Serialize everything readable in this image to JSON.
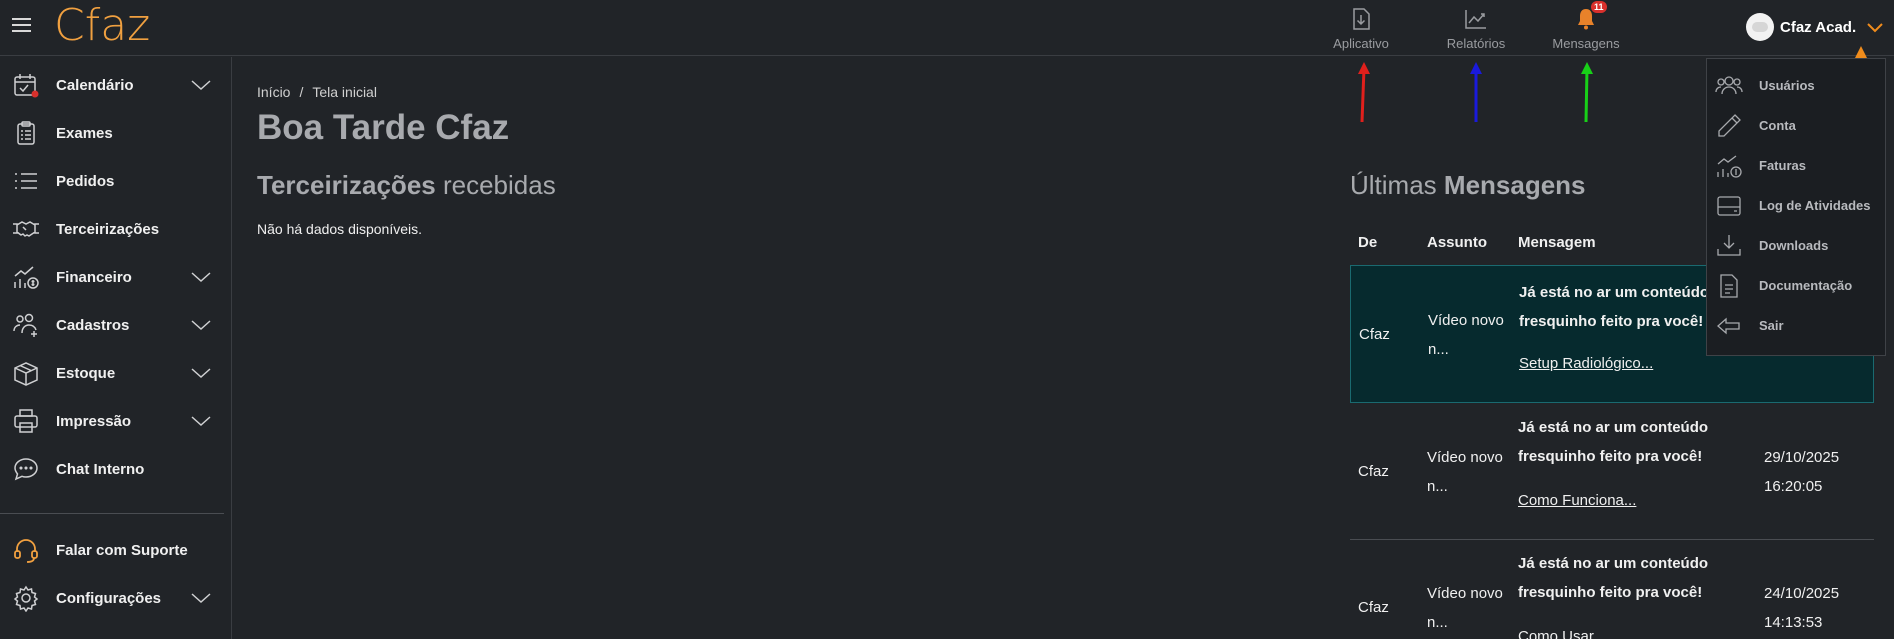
{
  "app": {
    "logo": "Cfaz"
  },
  "topnav": [
    {
      "label": "Aplicativo",
      "icon": "download-file-icon"
    },
    {
      "label": "Relatórios",
      "icon": "trend-chart-icon"
    },
    {
      "label": "Mensagens",
      "icon": "bell-icon",
      "badge": "11"
    }
  ],
  "user": {
    "name": "Cfaz Acad."
  },
  "sidebar": {
    "items": [
      {
        "label": "Calendário",
        "icon": "calendar-icon",
        "expandable": true
      },
      {
        "label": "Exames",
        "icon": "clipboard-icon",
        "expandable": false
      },
      {
        "label": "Pedidos",
        "icon": "list-icon",
        "expandable": false
      },
      {
        "label": "Terceirizações",
        "icon": "handshake-icon",
        "expandable": false
      },
      {
        "label": "Financeiro",
        "icon": "finance-icon",
        "expandable": true
      },
      {
        "label": "Cadastros",
        "icon": "users-icon",
        "expandable": true
      },
      {
        "label": "Estoque",
        "icon": "box-icon",
        "expandable": true
      },
      {
        "label": "Impressão",
        "icon": "printer-icon",
        "expandable": true
      },
      {
        "label": "Chat Interno",
        "icon": "chat-icon",
        "expandable": false
      }
    ],
    "bottom_items": [
      {
        "label": "Falar com Suporte",
        "icon": "headset-icon",
        "expandable": false
      },
      {
        "label": "Configurações",
        "icon": "gear-icon",
        "expandable": true
      }
    ]
  },
  "breadcrumb": {
    "home": "Início",
    "separator": "/",
    "current": "Tela inicial"
  },
  "greeting": "Boa Tarde Cfaz",
  "outsourcing": {
    "title_bold": "Terceirizações",
    "title_rest": " recebidas",
    "empty": "Não há dados disponíveis."
  },
  "messages": {
    "title_light": "Últimas ",
    "title_bold": "Mensagens",
    "headers": {
      "from": "De",
      "subject": "Assunto",
      "message": "Mensagem"
    },
    "rows": [
      {
        "from": "Cfaz",
        "subject_l1": "Vídeo novo",
        "subject_l2": "n...",
        "msg_l1": "Já está no ar um conteúdo",
        "msg_l2": "fresquinho feito pra você!",
        "link": "Setup Radiológico...",
        "date": "",
        "time": ""
      },
      {
        "from": "Cfaz",
        "subject_l1": "Vídeo novo",
        "subject_l2": "n...",
        "msg_l1": "Já está no ar um conteúdo",
        "msg_l2": "fresquinho feito pra você!",
        "link": "Como Funciona...",
        "date": "29/10/2025",
        "time": "16:20:05"
      },
      {
        "from": "Cfaz",
        "subject_l1": "Vídeo novo",
        "subject_l2": "n...",
        "msg_l1": "Já está no ar um conteúdo",
        "msg_l2": "fresquinho feito pra você!",
        "link": "Como Usar...",
        "date": "24/10/2025",
        "time": "14:13:53"
      }
    ]
  },
  "user_menu": [
    {
      "label": "Usuários",
      "icon": "users-icon"
    },
    {
      "label": "Conta",
      "icon": "pencil-icon"
    },
    {
      "label": "Faturas",
      "icon": "invoice-chart-icon"
    },
    {
      "label": "Log de Atividades",
      "icon": "log-card-icon"
    },
    {
      "label": "Downloads",
      "icon": "download-tray-icon"
    },
    {
      "label": "Documentação",
      "icon": "document-icon"
    },
    {
      "label": "Sair",
      "icon": "exit-arrow-icon"
    }
  ],
  "colors": {
    "accent": "#f0a040",
    "highlight_row": "#062a2e",
    "badge": "#d9302c"
  },
  "annotations": [
    {
      "color": "#e0201c",
      "target": "Aplicativo"
    },
    {
      "color": "#1a1adc",
      "target": "Relatórios"
    },
    {
      "color": "#18d018",
      "target": "Mensagens"
    },
    {
      "color": "#f08c1c",
      "target": "user-menu"
    }
  ]
}
